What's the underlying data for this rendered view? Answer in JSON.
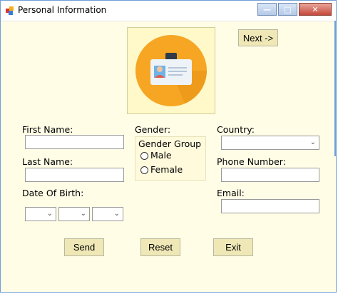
{
  "window": {
    "title": "Personal Information",
    "minimize_glyph": "—",
    "maximize_glyph": "□",
    "close_glyph": "✕"
  },
  "header": {
    "next_label": "Next ->",
    "avatar_icon": "id-badge-icon"
  },
  "form": {
    "first_name_label": "First Name:",
    "last_name_label": "Last Name:",
    "dob_label": "Date Of Birth:",
    "gender_label": "Gender:",
    "gender_group_title": "Gender Group",
    "gender_options": [
      "Male",
      "Female"
    ],
    "country_label": "Country:",
    "phone_label": "Phone Number:",
    "email_label": "Email:",
    "first_name_value": "",
    "last_name_value": "",
    "phone_value": "",
    "email_value": ""
  },
  "actions": {
    "send_label": "Send",
    "reset_label": "Reset",
    "exit_label": "Exit"
  },
  "colors": {
    "form_background": "#fffde6",
    "button_background": "#efe8b6",
    "icon_circle": "#f6a623"
  }
}
